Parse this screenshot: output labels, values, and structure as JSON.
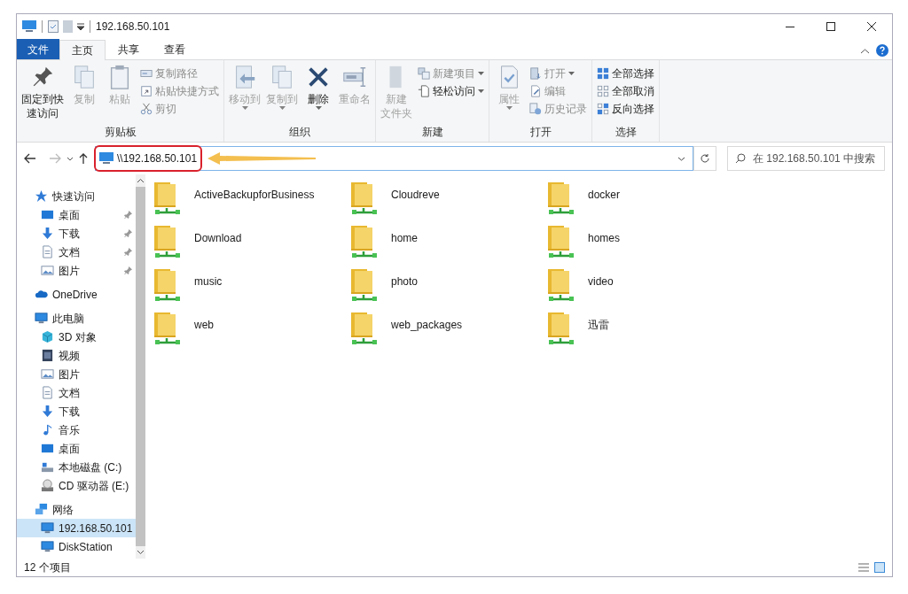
{
  "window": {
    "title": "192.168.50.101"
  },
  "tabs": [
    {
      "label": "文件",
      "kind": "file",
      "selected": false
    },
    {
      "label": "主页",
      "kind": "tab",
      "selected": true
    },
    {
      "label": "共享",
      "kind": "tab",
      "selected": false
    },
    {
      "label": "查看",
      "kind": "tab",
      "selected": false
    }
  ],
  "ribbon": {
    "groups": [
      {
        "label": "剪贴板",
        "large": [
          {
            "label_lines": [
              "固定到快",
              "速访问"
            ],
            "kind": "pin",
            "disabled": false,
            "dropdown": false
          },
          {
            "label_lines": [
              "复制"
            ],
            "kind": "copy",
            "disabled": true,
            "dropdown": false
          },
          {
            "label_lines": [
              "粘贴"
            ],
            "kind": "paste",
            "disabled": true,
            "dropdown": false
          }
        ],
        "small": [
          {
            "label": "复制路径",
            "kind": "path",
            "disabled": true,
            "dropdown": false
          },
          {
            "label": "粘贴快捷方式",
            "kind": "shortcut",
            "disabled": true,
            "dropdown": false
          },
          {
            "label": "剪切",
            "kind": "cut",
            "disabled": true,
            "dropdown": false
          }
        ]
      },
      {
        "label": "组织",
        "large": [
          {
            "label_lines": [
              "移动到"
            ],
            "kind": "move",
            "disabled": true,
            "dropdown": true
          },
          {
            "label_lines": [
              "复制到"
            ],
            "kind": "copyto",
            "disabled": true,
            "dropdown": true
          },
          {
            "label_lines": [
              "删除"
            ],
            "kind": "delete",
            "disabled": false,
            "dropdown": true
          },
          {
            "label_lines": [
              "重命名"
            ],
            "kind": "rename",
            "disabled": true,
            "dropdown": false
          }
        ]
      },
      {
        "label": "新建",
        "large": [
          {
            "label_lines": [
              "新建",
              "文件夹"
            ],
            "kind": "newfolder",
            "disabled": true,
            "dropdown": false
          }
        ],
        "small": [
          {
            "label": "新建项目",
            "kind": "newitem",
            "disabled": true,
            "dropdown": true
          },
          {
            "label": "轻松访问",
            "kind": "easy",
            "disabled": false,
            "dropdown": true
          }
        ]
      },
      {
        "label": "打开",
        "large": [
          {
            "label_lines": [
              "属性"
            ],
            "kind": "props",
            "disabled": true,
            "dropdown": true
          }
        ],
        "small": [
          {
            "label": "打开",
            "kind": "open",
            "disabled": true,
            "dropdown": true
          },
          {
            "label": "编辑",
            "kind": "edit",
            "disabled": true,
            "dropdown": false
          },
          {
            "label": "历史记录",
            "kind": "history",
            "disabled": true,
            "dropdown": false
          }
        ]
      },
      {
        "label": "选择",
        "small": [
          {
            "label": "全部选择",
            "kind": "selall",
            "disabled": false,
            "dropdown": false
          },
          {
            "label": "全部取消",
            "kind": "selnone",
            "disabled": false,
            "dropdown": false
          },
          {
            "label": "反向选择",
            "kind": "selinv",
            "disabled": false,
            "dropdown": false
          }
        ]
      }
    ]
  },
  "address_bar": {
    "path": "\\\\192.168.50.101",
    "search_placeholder": "在 192.168.50.101 中搜索"
  },
  "navigation": [
    {
      "label": "快速访问",
      "kind": "star",
      "selected": false,
      "children": [
        {
          "label": "桌面",
          "kind": "desktop",
          "selected": false,
          "pinned": true
        },
        {
          "label": "下载",
          "kind": "download",
          "selected": false,
          "pinned": true
        },
        {
          "label": "文档",
          "kind": "documents",
          "selected": false,
          "pinned": true
        },
        {
          "label": "图片",
          "kind": "pictures",
          "selected": false,
          "pinned": true
        }
      ]
    },
    {
      "label": "OneDrive",
      "kind": "cloud",
      "selected": false
    },
    {
      "label": "此电脑",
      "kind": "pc",
      "selected": false,
      "children": [
        {
          "label": "3D 对象",
          "kind": "objects3d",
          "selected": false
        },
        {
          "label": "视频",
          "kind": "videos",
          "selected": false
        },
        {
          "label": "图片",
          "kind": "pictures",
          "selected": false
        },
        {
          "label": "文档",
          "kind": "documents",
          "selected": false
        },
        {
          "label": "下载",
          "kind": "download",
          "selected": false
        },
        {
          "label": "音乐",
          "kind": "music",
          "selected": false
        },
        {
          "label": "桌面",
          "kind": "desktop",
          "selected": false
        },
        {
          "label": "本地磁盘 (C:)",
          "kind": "disk",
          "selected": false
        },
        {
          "label": "CD 驱动器 (E:)",
          "kind": "cdrom",
          "selected": false
        }
      ]
    },
    {
      "label": "网络",
      "kind": "network",
      "selected": false,
      "children": [
        {
          "label": "192.168.50.101",
          "kind": "pc",
          "selected": true
        },
        {
          "label": "DiskStation",
          "kind": "pc",
          "selected": false
        }
      ]
    }
  ],
  "folders": [
    "ActiveBackupforBusiness",
    "Cloudreve",
    "docker",
    "Download",
    "home",
    "homes",
    "music",
    "photo",
    "video",
    "web",
    "web_packages",
    "迅雷"
  ],
  "status_bar": {
    "count": "12 个项目"
  }
}
